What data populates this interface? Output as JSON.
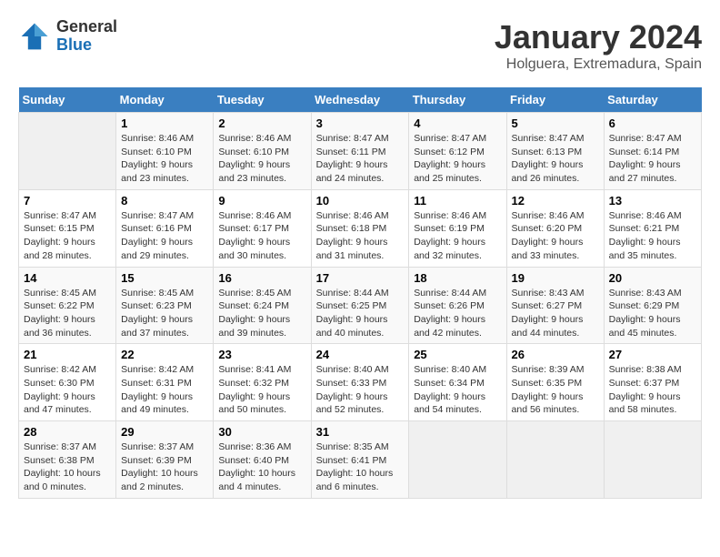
{
  "logo": {
    "general": "General",
    "blue": "Blue"
  },
  "title": "January 2024",
  "location": "Holguera, Extremadura, Spain",
  "days_header": [
    "Sunday",
    "Monday",
    "Tuesday",
    "Wednesday",
    "Thursday",
    "Friday",
    "Saturday"
  ],
  "weeks": [
    [
      {
        "day": "",
        "sunrise": "",
        "sunset": "",
        "daylight": ""
      },
      {
        "day": "1",
        "sunrise": "Sunrise: 8:46 AM",
        "sunset": "Sunset: 6:10 PM",
        "daylight": "Daylight: 9 hours and 23 minutes."
      },
      {
        "day": "2",
        "sunrise": "Sunrise: 8:46 AM",
        "sunset": "Sunset: 6:10 PM",
        "daylight": "Daylight: 9 hours and 23 minutes."
      },
      {
        "day": "3",
        "sunrise": "Sunrise: 8:47 AM",
        "sunset": "Sunset: 6:11 PM",
        "daylight": "Daylight: 9 hours and 24 minutes."
      },
      {
        "day": "4",
        "sunrise": "Sunrise: 8:47 AM",
        "sunset": "Sunset: 6:12 PM",
        "daylight": "Daylight: 9 hours and 25 minutes."
      },
      {
        "day": "5",
        "sunrise": "Sunrise: 8:47 AM",
        "sunset": "Sunset: 6:13 PM",
        "daylight": "Daylight: 9 hours and 26 minutes."
      },
      {
        "day": "6",
        "sunrise": "Sunrise: 8:47 AM",
        "sunset": "Sunset: 6:14 PM",
        "daylight": "Daylight: 9 hours and 27 minutes."
      }
    ],
    [
      {
        "day": "7",
        "sunrise": "Sunrise: 8:47 AM",
        "sunset": "Sunset: 6:15 PM",
        "daylight": "Daylight: 9 hours and 28 minutes."
      },
      {
        "day": "8",
        "sunrise": "Sunrise: 8:47 AM",
        "sunset": "Sunset: 6:16 PM",
        "daylight": "Daylight: 9 hours and 29 minutes."
      },
      {
        "day": "9",
        "sunrise": "Sunrise: 8:46 AM",
        "sunset": "Sunset: 6:17 PM",
        "daylight": "Daylight: 9 hours and 30 minutes."
      },
      {
        "day": "10",
        "sunrise": "Sunrise: 8:46 AM",
        "sunset": "Sunset: 6:18 PM",
        "daylight": "Daylight: 9 hours and 31 minutes."
      },
      {
        "day": "11",
        "sunrise": "Sunrise: 8:46 AM",
        "sunset": "Sunset: 6:19 PM",
        "daylight": "Daylight: 9 hours and 32 minutes."
      },
      {
        "day": "12",
        "sunrise": "Sunrise: 8:46 AM",
        "sunset": "Sunset: 6:20 PM",
        "daylight": "Daylight: 9 hours and 33 minutes."
      },
      {
        "day": "13",
        "sunrise": "Sunrise: 8:46 AM",
        "sunset": "Sunset: 6:21 PM",
        "daylight": "Daylight: 9 hours and 35 minutes."
      }
    ],
    [
      {
        "day": "14",
        "sunrise": "Sunrise: 8:45 AM",
        "sunset": "Sunset: 6:22 PM",
        "daylight": "Daylight: 9 hours and 36 minutes."
      },
      {
        "day": "15",
        "sunrise": "Sunrise: 8:45 AM",
        "sunset": "Sunset: 6:23 PM",
        "daylight": "Daylight: 9 hours and 37 minutes."
      },
      {
        "day": "16",
        "sunrise": "Sunrise: 8:45 AM",
        "sunset": "Sunset: 6:24 PM",
        "daylight": "Daylight: 9 hours and 39 minutes."
      },
      {
        "day": "17",
        "sunrise": "Sunrise: 8:44 AM",
        "sunset": "Sunset: 6:25 PM",
        "daylight": "Daylight: 9 hours and 40 minutes."
      },
      {
        "day": "18",
        "sunrise": "Sunrise: 8:44 AM",
        "sunset": "Sunset: 6:26 PM",
        "daylight": "Daylight: 9 hours and 42 minutes."
      },
      {
        "day": "19",
        "sunrise": "Sunrise: 8:43 AM",
        "sunset": "Sunset: 6:27 PM",
        "daylight": "Daylight: 9 hours and 44 minutes."
      },
      {
        "day": "20",
        "sunrise": "Sunrise: 8:43 AM",
        "sunset": "Sunset: 6:29 PM",
        "daylight": "Daylight: 9 hours and 45 minutes."
      }
    ],
    [
      {
        "day": "21",
        "sunrise": "Sunrise: 8:42 AM",
        "sunset": "Sunset: 6:30 PM",
        "daylight": "Daylight: 9 hours and 47 minutes."
      },
      {
        "day": "22",
        "sunrise": "Sunrise: 8:42 AM",
        "sunset": "Sunset: 6:31 PM",
        "daylight": "Daylight: 9 hours and 49 minutes."
      },
      {
        "day": "23",
        "sunrise": "Sunrise: 8:41 AM",
        "sunset": "Sunset: 6:32 PM",
        "daylight": "Daylight: 9 hours and 50 minutes."
      },
      {
        "day": "24",
        "sunrise": "Sunrise: 8:40 AM",
        "sunset": "Sunset: 6:33 PM",
        "daylight": "Daylight: 9 hours and 52 minutes."
      },
      {
        "day": "25",
        "sunrise": "Sunrise: 8:40 AM",
        "sunset": "Sunset: 6:34 PM",
        "daylight": "Daylight: 9 hours and 54 minutes."
      },
      {
        "day": "26",
        "sunrise": "Sunrise: 8:39 AM",
        "sunset": "Sunset: 6:35 PM",
        "daylight": "Daylight: 9 hours and 56 minutes."
      },
      {
        "day": "27",
        "sunrise": "Sunrise: 8:38 AM",
        "sunset": "Sunset: 6:37 PM",
        "daylight": "Daylight: 9 hours and 58 minutes."
      }
    ],
    [
      {
        "day": "28",
        "sunrise": "Sunrise: 8:37 AM",
        "sunset": "Sunset: 6:38 PM",
        "daylight": "Daylight: 10 hours and 0 minutes."
      },
      {
        "day": "29",
        "sunrise": "Sunrise: 8:37 AM",
        "sunset": "Sunset: 6:39 PM",
        "daylight": "Daylight: 10 hours and 2 minutes."
      },
      {
        "day": "30",
        "sunrise": "Sunrise: 8:36 AM",
        "sunset": "Sunset: 6:40 PM",
        "daylight": "Daylight: 10 hours and 4 minutes."
      },
      {
        "day": "31",
        "sunrise": "Sunrise: 8:35 AM",
        "sunset": "Sunset: 6:41 PM",
        "daylight": "Daylight: 10 hours and 6 minutes."
      },
      {
        "day": "",
        "sunrise": "",
        "sunset": "",
        "daylight": ""
      },
      {
        "day": "",
        "sunrise": "",
        "sunset": "",
        "daylight": ""
      },
      {
        "day": "",
        "sunrise": "",
        "sunset": "",
        "daylight": ""
      }
    ]
  ]
}
